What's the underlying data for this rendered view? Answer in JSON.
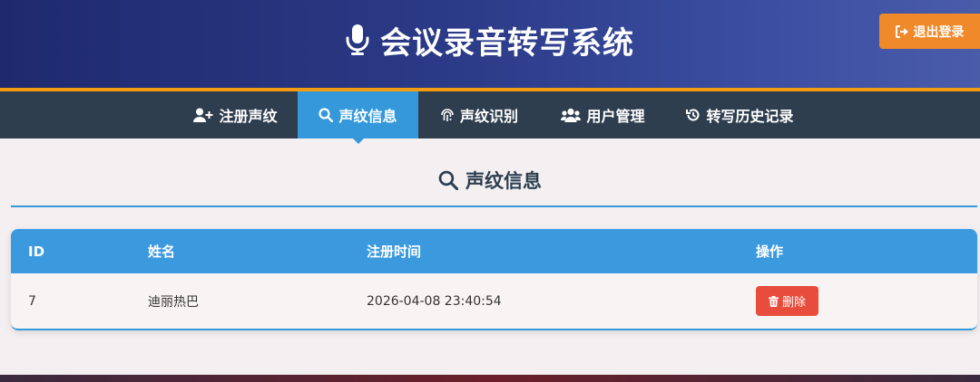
{
  "header": {
    "title": "会议录音转写系统",
    "logout_label": "退出登录",
    "bg_color": "#2b3a86",
    "accent_color": "#f39c12"
  },
  "nav": {
    "items": [
      {
        "label": "注册声纹",
        "icon": "user-plus-icon",
        "active": false
      },
      {
        "label": "声纹信息",
        "icon": "search-icon",
        "active": true
      },
      {
        "label": "声纹识别",
        "icon": "fingerprint-icon",
        "active": false
      },
      {
        "label": "用户管理",
        "icon": "users-icon",
        "active": false
      },
      {
        "label": "转写历史记录",
        "icon": "history-icon",
        "active": false
      }
    ],
    "active_color": "#3498db"
  },
  "section": {
    "title": "声纹信息",
    "icon": "search-icon"
  },
  "table": {
    "headers": [
      "ID",
      "姓名",
      "注册时间",
      "操作"
    ],
    "rows": [
      {
        "id": "7",
        "name": "迪丽热巴",
        "registered": "2026-04-08 23:40:54",
        "action_label": "删除"
      }
    ],
    "header_color": "#3b9ade",
    "delete_color": "#e74c3c"
  }
}
